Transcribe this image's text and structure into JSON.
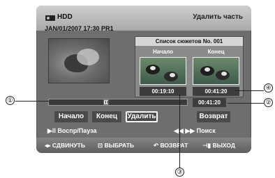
{
  "header": {
    "source_label": "HDD",
    "screen_title": "Удалить часть",
    "datetime_channel": "JAN/01/2007 17:30 PR1"
  },
  "title_list": {
    "heading": "Список сюжетов No. 001",
    "start_label": "Начало",
    "end_label": "Конец",
    "start_time": "00:19:10",
    "end_time": "00:41:20"
  },
  "playback": {
    "progress_fraction": 0.41,
    "current_time": "00:41:20"
  },
  "buttons": {
    "start": "Начало",
    "end": "Конец",
    "delete": "Удалить",
    "return": "Возврат",
    "selected": "delete"
  },
  "hints": {
    "play_pause": "▶ll Воспр/Пауза",
    "search": "◀◀ ▶▶ Поиск"
  },
  "nav": {
    "move": "◂▸ СДВИНУТЬ",
    "select": "⊡ ВЫБРАТЬ",
    "back": "↶ ВОЗВРАТ",
    "exit": "⊣▮ ВЫХОД"
  },
  "callouts": [
    "①",
    "②",
    "③",
    "④"
  ],
  "colors": {
    "osd_background": "#6e6e6e",
    "header_gradient_top": "#cfcfcf",
    "button_background": "#4a4a4a",
    "time_box": "#3d3d3d"
  }
}
